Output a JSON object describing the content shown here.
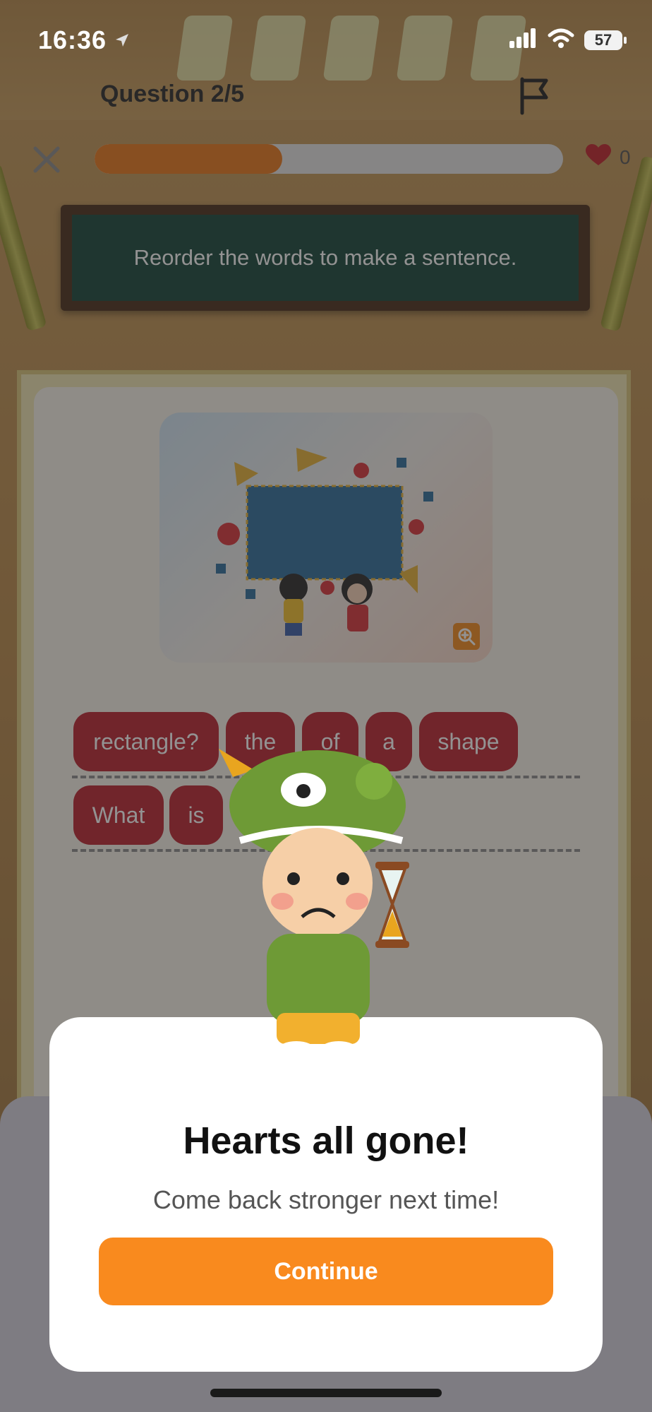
{
  "status_bar": {
    "time": "16:36",
    "battery": "57"
  },
  "header": {
    "question_label": "Question 2/5",
    "progress_fraction": 0.4,
    "hearts_count": "0"
  },
  "instruction": {
    "text": "Reorder the words to make a sentence."
  },
  "word_bank": {
    "row1": [
      "rectangle?",
      "the",
      "of",
      "a",
      "shape"
    ],
    "row2": [
      "What",
      "is"
    ]
  },
  "icons": {
    "location": "location-arrow-icon",
    "signal": "signal-icon",
    "wifi": "wifi-icon",
    "flag": "flag-icon",
    "close": "close-icon",
    "heart": "heart-icon",
    "zoom": "zoom-in-icon"
  },
  "colors": {
    "accent": "#f98a1e",
    "chip": "#bb2430",
    "board": "#16473a",
    "progress": "#e8781d"
  },
  "modal": {
    "title": "Hearts all gone!",
    "subtitle": "Come back stronger next time!",
    "button_label": "Continue"
  }
}
